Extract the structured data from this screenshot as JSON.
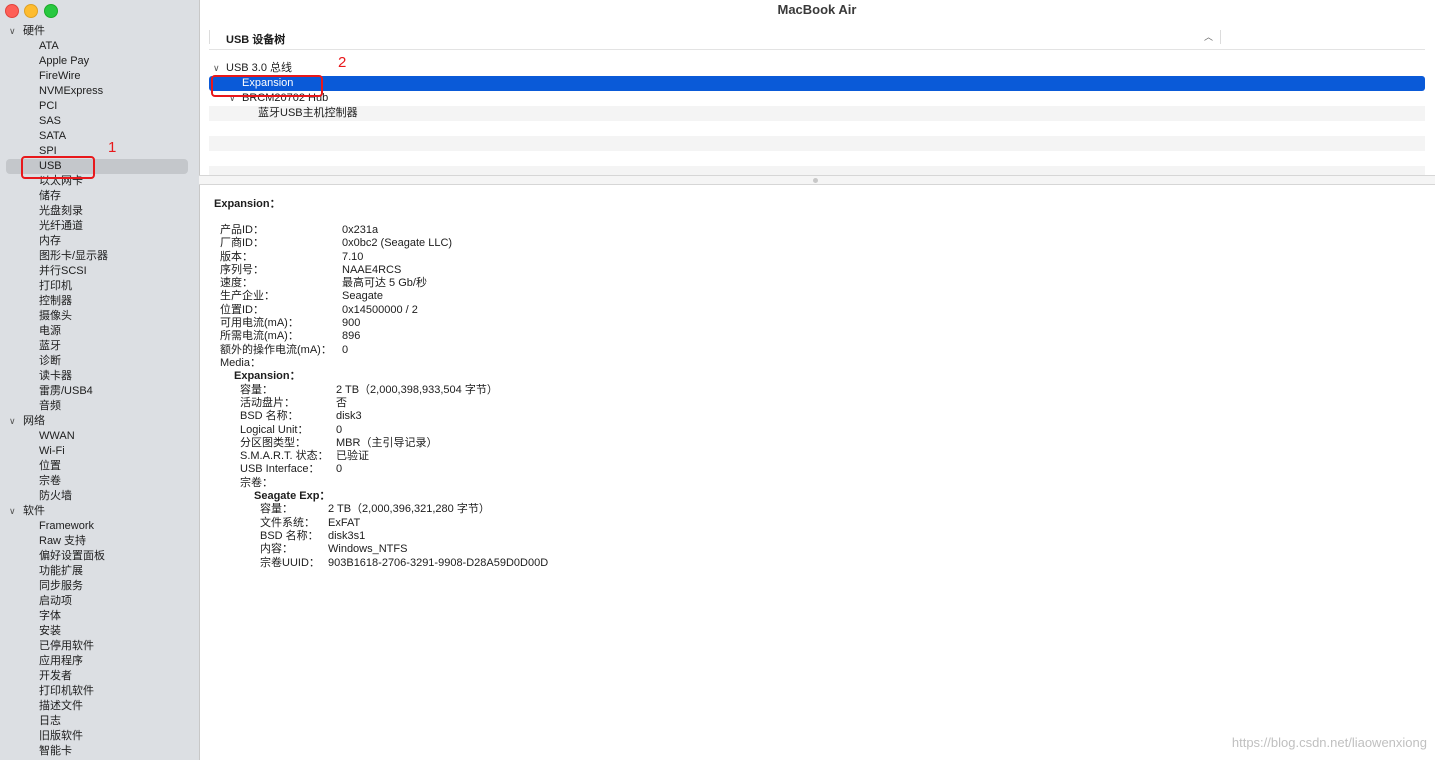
{
  "window": {
    "title": "MacBook Air"
  },
  "sidebar": {
    "rows": [
      {
        "label": "硬件",
        "type": "cat"
      },
      {
        "label": "ATA",
        "type": "item"
      },
      {
        "label": "Apple Pay",
        "type": "item"
      },
      {
        "label": "FireWire",
        "type": "item"
      },
      {
        "label": "NVMExpress",
        "type": "item"
      },
      {
        "label": "PCI",
        "type": "item"
      },
      {
        "label": "SAS",
        "type": "item"
      },
      {
        "label": "SATA",
        "type": "item"
      },
      {
        "label": "SPI",
        "type": "item"
      },
      {
        "label": "USB",
        "type": "item",
        "selected": true
      },
      {
        "label": "以太网卡",
        "type": "item"
      },
      {
        "label": "储存",
        "type": "item"
      },
      {
        "label": "光盘刻录",
        "type": "item"
      },
      {
        "label": "光纤通道",
        "type": "item"
      },
      {
        "label": "内存",
        "type": "item"
      },
      {
        "label": "图形卡/显示器",
        "type": "item"
      },
      {
        "label": "并行SCSI",
        "type": "item"
      },
      {
        "label": "打印机",
        "type": "item"
      },
      {
        "label": "控制器",
        "type": "item"
      },
      {
        "label": "摄像头",
        "type": "item"
      },
      {
        "label": "电源",
        "type": "item"
      },
      {
        "label": "蓝牙",
        "type": "item"
      },
      {
        "label": "诊断",
        "type": "item"
      },
      {
        "label": "读卡器",
        "type": "item"
      },
      {
        "label": "雷雳/USB4",
        "type": "item"
      },
      {
        "label": "音频",
        "type": "item"
      },
      {
        "label": "网络",
        "type": "cat"
      },
      {
        "label": "WWAN",
        "type": "item"
      },
      {
        "label": "Wi-Fi",
        "type": "item"
      },
      {
        "label": "位置",
        "type": "item"
      },
      {
        "label": "宗卷",
        "type": "item"
      },
      {
        "label": "防火墙",
        "type": "item"
      },
      {
        "label": "软件",
        "type": "cat"
      },
      {
        "label": "Framework",
        "type": "item"
      },
      {
        "label": "Raw 支持",
        "type": "item"
      },
      {
        "label": "偏好设置面板",
        "type": "item"
      },
      {
        "label": "功能扩展",
        "type": "item"
      },
      {
        "label": "同步服务",
        "type": "item"
      },
      {
        "label": "启动项",
        "type": "item"
      },
      {
        "label": "字体",
        "type": "item"
      },
      {
        "label": "安装",
        "type": "item"
      },
      {
        "label": "已停用软件",
        "type": "item"
      },
      {
        "label": "应用程序",
        "type": "item"
      },
      {
        "label": "开发者",
        "type": "item"
      },
      {
        "label": "打印机软件",
        "type": "item"
      },
      {
        "label": "描述文件",
        "type": "item"
      },
      {
        "label": "日志",
        "type": "item"
      },
      {
        "label": "旧版软件",
        "type": "item"
      },
      {
        "label": "智能卡",
        "type": "item"
      }
    ]
  },
  "tree": {
    "header": "USB 设备树",
    "nodes": [
      {
        "label": "USB 3.0 总线",
        "level": 0,
        "expanded": true
      },
      {
        "label": "Expansion",
        "level": 1,
        "selected": true
      },
      {
        "label": "BRCM20702 Hub",
        "level": 1,
        "expanded": true
      },
      {
        "label": "蓝牙USB主机控制器",
        "level": 2
      }
    ]
  },
  "detail": {
    "title": "Expansion：",
    "device": [
      {
        "key": "产品ID：",
        "value": "0x231a"
      },
      {
        "key": "厂商ID：",
        "value": "0x0bc2  (Seagate LLC)"
      },
      {
        "key": "版本：",
        "value": "7.10"
      },
      {
        "key": "序列号：",
        "value": "NAAE4RCS"
      },
      {
        "key": "速度：",
        "value": "最高可达 5 Gb/秒"
      },
      {
        "key": "生产企业：",
        "value": "Seagate"
      },
      {
        "key": "位置ID：",
        "value": "0x14500000 / 2"
      },
      {
        "key": "可用电流(mA)：",
        "value": "900"
      },
      {
        "key": "所需电流(mA)：",
        "value": "896"
      },
      {
        "key": "额外的操作电流(mA)：",
        "value": "0"
      }
    ],
    "media_label": "Media：",
    "media_title": "Expansion：",
    "media": [
      {
        "key": "容量：",
        "value": "2 TB（2,000,398,933,504 字节）"
      },
      {
        "key": "活动盘片：",
        "value": "否"
      },
      {
        "key": "BSD 名称：",
        "value": "disk3"
      },
      {
        "key": "Logical Unit：",
        "value": "0"
      },
      {
        "key": "分区图类型：",
        "value": "MBR（主引导记录）"
      },
      {
        "key": "S.M.A.R.T. 状态：",
        "value": "已验证"
      },
      {
        "key": "USB Interface：",
        "value": "0"
      }
    ],
    "volumes_label": "宗卷：",
    "volume_title": "Seagate Exp：",
    "volume": [
      {
        "key": "容量：",
        "value": "2 TB（2,000,396,321,280 字节）"
      },
      {
        "key": "文件系统：",
        "value": "ExFAT"
      },
      {
        "key": "BSD 名称：",
        "value": "disk3s1"
      },
      {
        "key": "内容：",
        "value": "Windows_NTFS"
      },
      {
        "key": "宗卷UUID：",
        "value": "903B1618-2706-3291-9908-D28A59D0D00D"
      }
    ]
  },
  "annotations": {
    "step1": "1",
    "step2": "2"
  },
  "watermark": "https://blog.csdn.net/liaowenxiong"
}
